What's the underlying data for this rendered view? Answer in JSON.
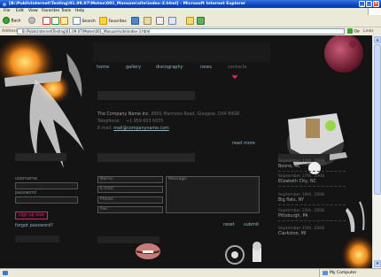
{
  "window": {
    "title": "[B:\\PublicInternet\\Testing\\01.09.07\\Motes\\001_Manusm\\site\\index-3.html] - Microsoft Internet Explorer"
  },
  "menu": [
    "File",
    "Edit",
    "View",
    "Favorites",
    "Tools",
    "Help"
  ],
  "toolbar": {
    "back": "Back",
    "search": "Search",
    "favorites": "Favorites"
  },
  "address": {
    "label": "Address",
    "value": "B:\\PublicInternet\\Testing\\01.09.07\\Motes\\001_Manusm\\site\\index-3.html",
    "go": "Go",
    "links": "Links"
  },
  "status": {
    "zone": "My Computer"
  },
  "site": {
    "nav": [
      "home",
      "gallery",
      "discography",
      "news",
      "contacts"
    ],
    "company": {
      "name": "The Company Name Inc.",
      "address": "8901 Marmora Road, Glasgow, D04 89GR.",
      "telephone_label": "Telephone:",
      "telephone": "+1 959 603 6035",
      "email_label": "E-mail:",
      "email": "mail@companyname.com",
      "read_more": "read more"
    },
    "login": {
      "username_label": "username",
      "password_label": "password",
      "signup": "sign up now",
      "forgot": "forgot password?"
    },
    "form": {
      "name": "Name:",
      "email": "E-mail:",
      "phone": "Phone:",
      "fax": "Fax:",
      "message": "Message:",
      "reset": "reset",
      "submit": "submit"
    },
    "news": [
      {
        "date": "September 15th, 2008",
        "place": "Boone, NC"
      },
      {
        "date": "September 17th, 2008",
        "place": "Elizabeth City, NC"
      },
      {
        "date": "September 18th, 2008",
        "place": "Big flats, NY"
      },
      {
        "date": "September 22th, 2008",
        "place": "Pittsburgh, PA"
      },
      {
        "date": "September 23th, 2008",
        "place": "Clarkston, MI"
      }
    ]
  },
  "colors": {
    "accent": "#e0246a",
    "link": "#8fb3c3",
    "page_bg": "#141414"
  }
}
